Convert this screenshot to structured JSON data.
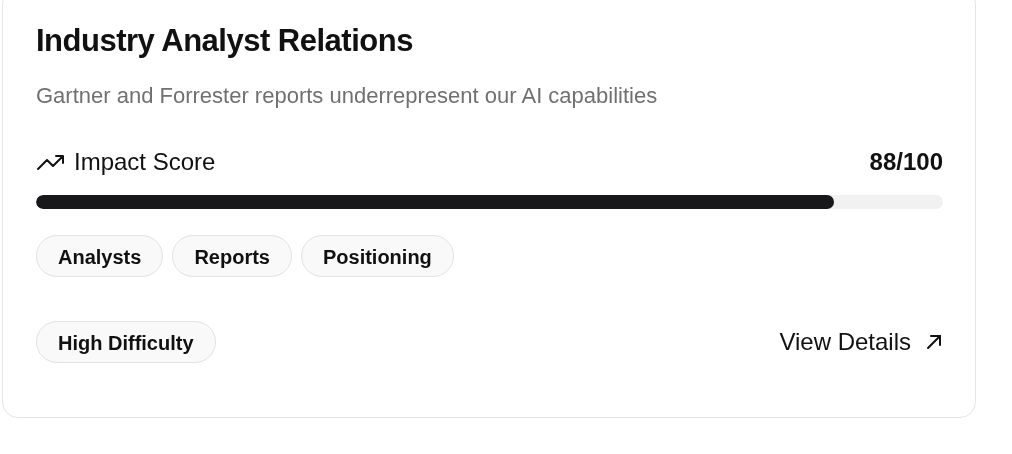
{
  "card": {
    "title": "Industry Analyst Relations",
    "subtitle": "Gartner and Forrester reports underrepresent our AI capabilities"
  },
  "impact": {
    "label": "Impact Score",
    "score": "88/100",
    "level": 0.88
  },
  "tags": [
    "Analysts",
    "Reports",
    "Positioning"
  ],
  "difficulty": "High Difficulty",
  "link": "View Details"
}
